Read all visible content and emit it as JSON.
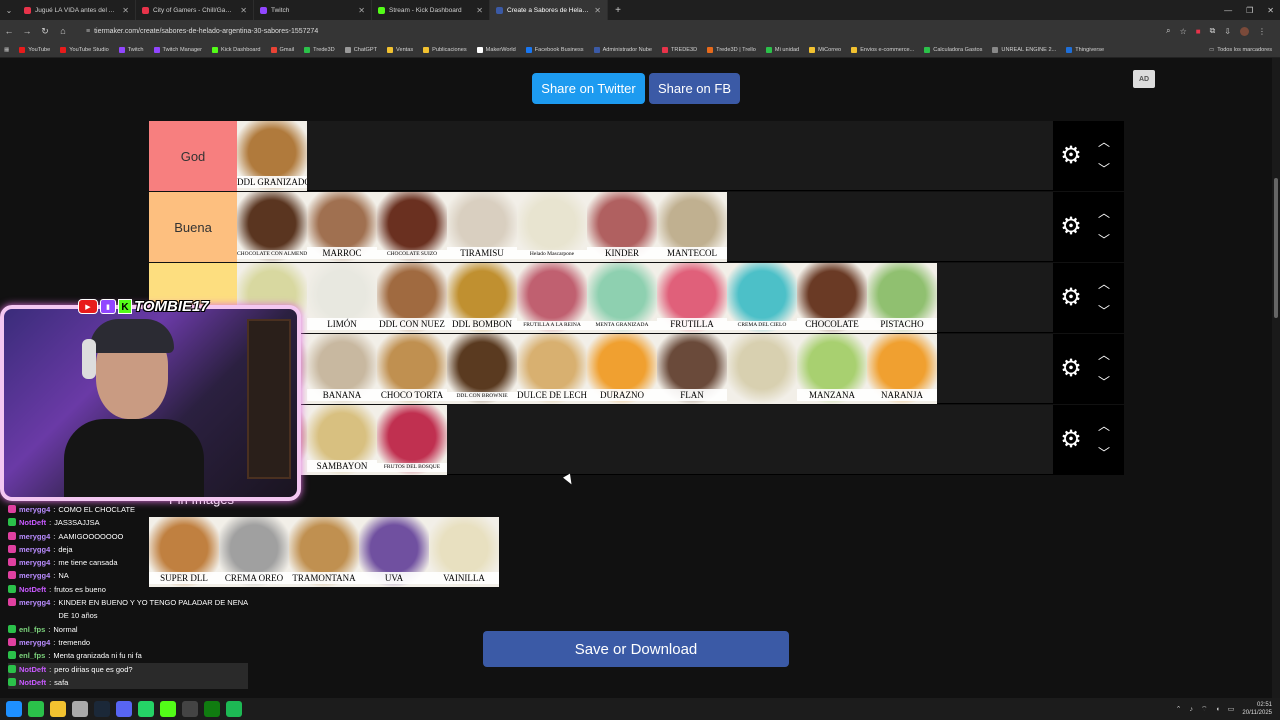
{
  "browser": {
    "tabs": [
      {
        "label": "Jugué LA VIDA antes del APOC",
        "color": "#e8334a",
        "active": false
      },
      {
        "label": "City of Gamers - Chill/Gaming",
        "color": "#e8334a",
        "active": false
      },
      {
        "label": "Twitch",
        "color": "#9146ff",
        "active": false
      },
      {
        "label": "Stream - Kick Dashboard",
        "color": "#53fc18",
        "active": false
      },
      {
        "label": "Create a Sabores de Helado Ar",
        "color": "#3b5aa6",
        "active": true
      }
    ],
    "url": "tiermaker.com/create/sabores-de-helado-argentina-30-sabores-1557274",
    "bookmarks": [
      {
        "label": "YouTube",
        "color": "#e81b1b"
      },
      {
        "label": "YouTube Studio",
        "color": "#e81b1b"
      },
      {
        "label": "Twitch",
        "color": "#9146ff"
      },
      {
        "label": "Twitch Manager",
        "color": "#9146ff"
      },
      {
        "label": "Kick Dashboard",
        "color": "#53fc18"
      },
      {
        "label": "Gmail",
        "color": "#ea4335"
      },
      {
        "label": "Trede3D",
        "color": "#2bc14a"
      },
      {
        "label": "ChatGPT",
        "color": "#999999"
      },
      {
        "label": "Ventas",
        "color": "#f2c230"
      },
      {
        "label": "Publicaciones",
        "color": "#f2c230"
      },
      {
        "label": "MakerWorld",
        "color": "#ffffff"
      },
      {
        "label": "Facebook Business",
        "color": "#1877f2"
      },
      {
        "label": "Administrador Nube",
        "color": "#3b5aa6"
      },
      {
        "label": "TREDE3D",
        "color": "#e8334a"
      },
      {
        "label": "Trede3D | Trello",
        "color": "#e86a1b"
      },
      {
        "label": "Mi unidad",
        "color": "#2bc14a"
      },
      {
        "label": "MiCorreo",
        "color": "#f2c230"
      },
      {
        "label": "Envios e-commerce...",
        "color": "#f2c230"
      },
      {
        "label": "Calculadora Gastos",
        "color": "#2bc14a"
      },
      {
        "label": "UNREAL ENGINE 2...",
        "color": "#888888"
      },
      {
        "label": "Thingiverse",
        "color": "#1e6fd9"
      }
    ],
    "all_bookmarks": "Todos los marcadores"
  },
  "page": {
    "share_twitter": "Share on Twitter",
    "share_fb": "Share on FB",
    "ad": "AD",
    "pin_images": "Pin Images",
    "save_download": "Save or Download"
  },
  "tiers": [
    {
      "label": "God",
      "color": "#f77f7f",
      "items": [
        {
          "caption": "DDL GRANIZADO",
          "bg": "#b07a3c"
        }
      ]
    },
    {
      "label": "Buena",
      "color": "#fdbf7f",
      "items": [
        {
          "caption": "CHOCOLATE CON ALMENDRAS",
          "bg": "#5a3520"
        },
        {
          "caption": "MARROC",
          "bg": "#a07050"
        },
        {
          "caption": "CHOCOLATE SUIZO",
          "bg": "#6a3020"
        },
        {
          "caption": "TIRAMISU",
          "bg": "#d9cfc0"
        },
        {
          "caption": "Helado Mascarpone",
          "bg": "#e8e4d0"
        },
        {
          "caption": "KINDER",
          "bg": "#b06060"
        },
        {
          "caption": "MANTECOL",
          "bg": "#c0b090"
        }
      ]
    },
    {
      "label": "",
      "color": "#fdde7f",
      "items": [
        {
          "caption": "",
          "bg": "#d8d8a0"
        },
        {
          "caption": "LIMÓN",
          "bg": "#e8e8e0"
        },
        {
          "caption": "DDL CON NUEZ",
          "bg": "#a06a40"
        },
        {
          "caption": "DDL BOMBON",
          "bg": "#c09030"
        },
        {
          "caption": "FRUTILLA A LA REINA",
          "bg": "#c06070"
        },
        {
          "caption": "MENTA GRANIZADA",
          "bg": "#8ed0b0"
        },
        {
          "caption": "FRUTILLA",
          "bg": "#e0607a"
        },
        {
          "caption": "CREMA DEL CIELO",
          "bg": "#4cc0c8"
        },
        {
          "caption": "CHOCOLATE",
          "bg": "#6a3a25"
        },
        {
          "caption": "PISTACHO",
          "bg": "#90c070"
        }
      ]
    },
    {
      "label": "",
      "color": "#fefe7f",
      "items": [
        {
          "caption": "",
          "bg": "#c0a890"
        },
        {
          "caption": "BANANA",
          "bg": "#c8b8a0"
        },
        {
          "caption": "CHOCO TORTA",
          "bg": "#c09050"
        },
        {
          "caption": "DDL CON BROWNIE",
          "bg": "#5a3a20"
        },
        {
          "caption": "DULCE DE LECHE",
          "bg": "#d8b070"
        },
        {
          "caption": "DURAZNO",
          "bg": "#f0a030"
        },
        {
          "caption": "FLAN",
          "bg": "#6a4a3a"
        },
        {
          "caption": "",
          "bg": "#d8d0b0"
        },
        {
          "caption": "MANZANA",
          "bg": "#a8d070"
        },
        {
          "caption": "NARANJA",
          "bg": "#f0a030"
        }
      ]
    },
    {
      "label": "",
      "color": "#bfff7f",
      "items": [
        {
          "caption": "",
          "bg": "#c08060"
        },
        {
          "caption": "SAMBAYON",
          "bg": "#d8c080"
        },
        {
          "caption": "FRUTOS DEL BOSQUE",
          "bg": "#c03050"
        }
      ]
    }
  ],
  "pool_items": [
    {
      "caption": "SUPER DLL",
      "bg": "#c08040"
    },
    {
      "caption": "CREMA OREO",
      "bg": "#a0a0a0"
    },
    {
      "caption": "TRAMONTANA",
      "bg": "#c09050"
    },
    {
      "caption": "UVA",
      "bg": "#7050a0"
    },
    {
      "caption": "VAINILLA",
      "bg": "#e8e0c0"
    }
  ],
  "overlay": {
    "streamer": "TOMBIE17",
    "chat": [
      {
        "user": "merygg4",
        "msg": "COMO EL CHOCLATE",
        "color": "#b98cff",
        "badge": "heart"
      },
      {
        "user": "NotDeft",
        "msg": "JAS3SAJJSA",
        "color": "#c85aff",
        "badge": "check"
      },
      {
        "user": "merygg4",
        "msg": "AAMIGOOOOOOO",
        "color": "#b98cff",
        "badge": "heart"
      },
      {
        "user": "merygg4",
        "msg": "deja",
        "color": "#b98cff",
        "badge": "heart"
      },
      {
        "user": "merygg4",
        "msg": "me tiene cansada",
        "color": "#b98cff",
        "badge": "heart"
      },
      {
        "user": "merygg4",
        "msg": "NA",
        "color": "#b98cff",
        "badge": "heart"
      },
      {
        "user": "NotDeft",
        "msg": "frutos es bueno",
        "color": "#c85aff",
        "badge": "check"
      },
      {
        "user": "merygg4",
        "msg": "KINDER EN BUENO Y YO TENGO PALADAR DE NENA DE 10 años",
        "color": "#b98cff",
        "badge": "heart"
      },
      {
        "user": "enl_fps",
        "msg": "Normal",
        "color": "#7cd47c",
        "badge": "check"
      },
      {
        "user": "merygg4",
        "msg": "tremendo",
        "color": "#b98cff",
        "badge": "heart"
      },
      {
        "user": "enl_fps",
        "msg": "Menta granizada ni fu ni fa",
        "color": "#7cd47c",
        "badge": "check"
      },
      {
        "user": "NotDeft",
        "msg": "pero dirias que es god?",
        "color": "#c85aff",
        "badge": "check"
      },
      {
        "user": "NotDeft",
        "msg": "safa",
        "color": "#c85aff",
        "badge": "check"
      }
    ]
  },
  "taskbar": {
    "time": "02:51",
    "date": "20/11/2025",
    "apps": [
      {
        "name": "windows-start",
        "color": "#1e90ff"
      },
      {
        "name": "chrome",
        "color": "#2bc14a"
      },
      {
        "name": "file-explorer",
        "color": "#f2c230"
      },
      {
        "name": "notepad",
        "color": "#aaaaaa"
      },
      {
        "name": "steam",
        "color": "#1b2838"
      },
      {
        "name": "discord",
        "color": "#5865f2"
      },
      {
        "name": "whatsapp",
        "color": "#25d366"
      },
      {
        "name": "kick",
        "color": "#53fc18"
      },
      {
        "name": "obs",
        "color": "#444444"
      },
      {
        "name": "xbox",
        "color": "#107c10"
      },
      {
        "name": "spotify",
        "color": "#1db954"
      }
    ]
  }
}
